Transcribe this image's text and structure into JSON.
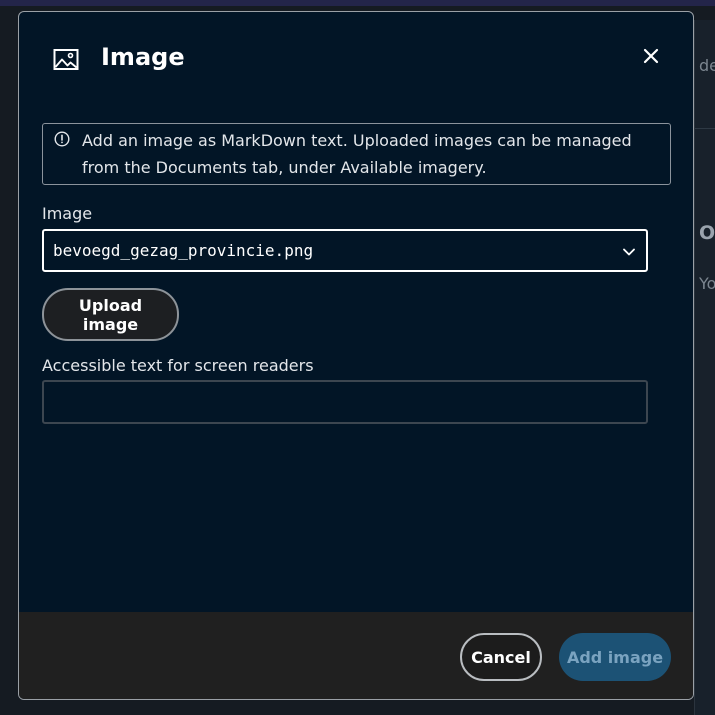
{
  "background": {
    "fragments": [
      "de",
      "Ole",
      "You"
    ]
  },
  "dialog": {
    "title": "Image",
    "title_icon": "image-icon",
    "close_icon": "close-icon",
    "notice": {
      "icon": "info-circle-icon",
      "text": "Add an image as MarkDown text. Uploaded images can be managed from the Documents tab, under Available imagery."
    },
    "image_field": {
      "label": "Image",
      "selected": "bevoegd_gezag_provincie.png",
      "chevron_icon": "chevron-down-icon"
    },
    "upload_label": "Upload image",
    "alt_field": {
      "label": "Accessible text for screen readers",
      "value": ""
    },
    "footer": {
      "cancel_label": "Cancel",
      "add_label": "Add image"
    }
  },
  "colors": {
    "dialog_bg": "#021526",
    "footer_bg": "#202020",
    "primary_disabled": "#1c5275"
  }
}
